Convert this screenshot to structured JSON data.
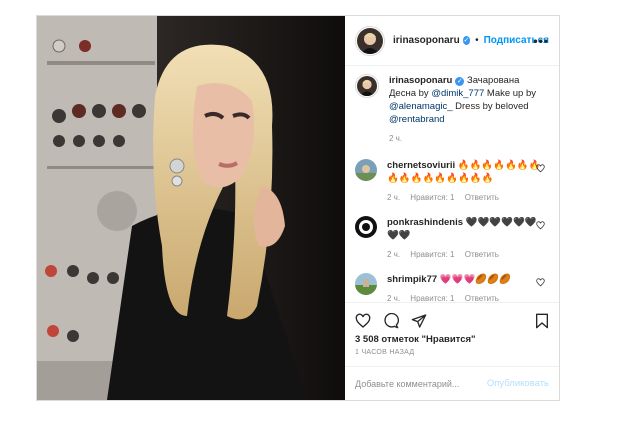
{
  "post": {
    "username": "irinasoponaru",
    "follow_label": "Подписаться",
    "dot": "•",
    "more": "•••",
    "caption": {
      "username": "irinasoponaru",
      "text_1": "Зачарована Десна by ",
      "mention_1": "@dimik_777",
      "text_2": " Make up by ",
      "mention_2": "@alenamagic_",
      "text_3": " Dress by beloved ",
      "mention_3": "@rentabrand",
      "time": "2 ч."
    },
    "comments": [
      {
        "username": "chernetsoviurii",
        "text": "🔥🔥🔥🔥🔥🔥🔥🔥🔥🔥🔥🔥🔥🔥🔥🔥",
        "time": "2 ч.",
        "likes": "Нравится: 1",
        "reply": "Ответить"
      },
      {
        "username": "ponkrashindenis",
        "text": "🖤🖤🖤🖤🖤🖤🖤🖤",
        "time": "2 ч.",
        "likes": "Нравится: 1",
        "reply": "Ответить"
      },
      {
        "username": "shrimpik77",
        "text": "💗💗💗🏉🏉🏉",
        "time": "2 ч.",
        "likes": "Нравится: 1",
        "reply": "Ответить"
      }
    ],
    "likes_count": "3 508 отметок \"Нравится\"",
    "timestamp": "1 ЧАСОВ НАЗАД",
    "comment_placeholder": "Добавьте комментарий...",
    "publish_label": "Опубликовать"
  }
}
